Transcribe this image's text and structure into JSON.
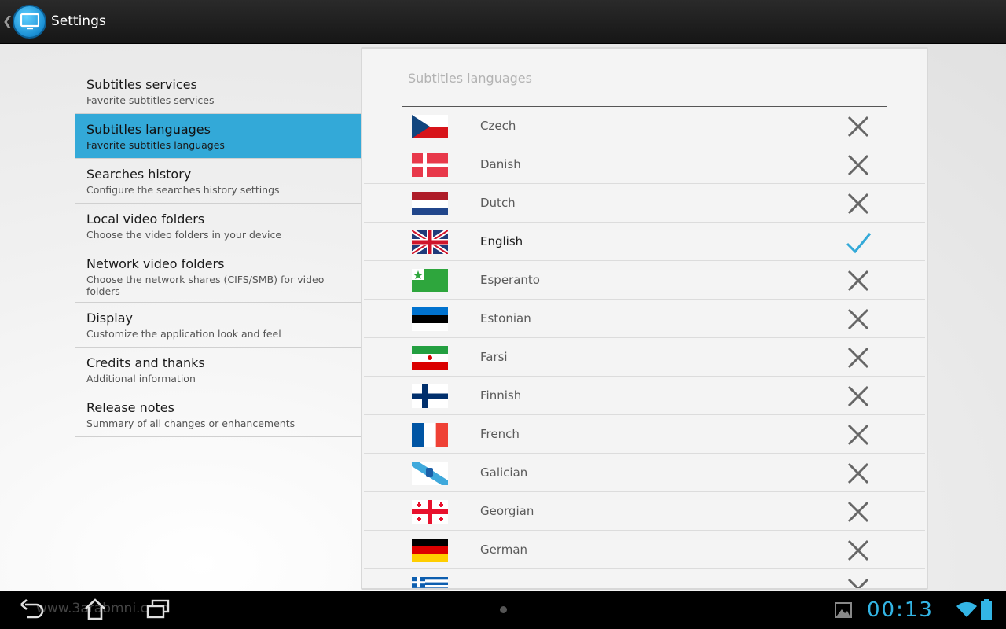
{
  "app": {
    "title": "Settings"
  },
  "headers": [
    {
      "title": "Subtitles services",
      "summary": "Favorite subtitles services",
      "selected": false
    },
    {
      "title": "Subtitles languages",
      "summary": "Favorite subtitles languages",
      "selected": true
    },
    {
      "title": "Searches history",
      "summary": "Configure the searches history settings",
      "selected": false
    },
    {
      "title": "Local video folders",
      "summary": "Choose the video folders in your device",
      "selected": false
    },
    {
      "title": "Network video folders",
      "summary": "Choose the network shares (CIFS/SMB) for video folders",
      "selected": false
    },
    {
      "title": "Display",
      "summary": "Customize the application look and feel",
      "selected": false
    },
    {
      "title": "Credits and thanks",
      "summary": "Additional information",
      "selected": false
    },
    {
      "title": "Release notes",
      "summary": "Summary of all changes or enhancements",
      "selected": false
    }
  ],
  "panel": {
    "title": "Subtitles languages",
    "languages": [
      {
        "name": "Czech",
        "flag": "czech-flag-icon",
        "selected": false
      },
      {
        "name": "Danish",
        "flag": "danish-flag-icon",
        "selected": false
      },
      {
        "name": "Dutch",
        "flag": "dutch-flag-icon",
        "selected": false
      },
      {
        "name": "English",
        "flag": "english-flag-icon",
        "selected": true
      },
      {
        "name": "Esperanto",
        "flag": "esperanto-flag-icon",
        "selected": false
      },
      {
        "name": "Estonian",
        "flag": "estonian-flag-icon",
        "selected": false
      },
      {
        "name": "Farsi",
        "flag": "farsi-flag-icon",
        "selected": false
      },
      {
        "name": "Finnish",
        "flag": "finnish-flag-icon",
        "selected": false
      },
      {
        "name": "French",
        "flag": "french-flag-icon",
        "selected": false
      },
      {
        "name": "Galician",
        "flag": "galician-flag-icon",
        "selected": false
      },
      {
        "name": "Georgian",
        "flag": "georgian-flag-icon",
        "selected": false
      },
      {
        "name": "German",
        "flag": "german-flag-icon",
        "selected": false
      },
      {
        "name": "",
        "flag": "greek-flag-icon",
        "selected": false
      }
    ]
  },
  "navbar": {
    "watermark": "www.3arabmni.com",
    "clock": "00:13"
  },
  "colors": {
    "accent": "#33b5e5",
    "selected_header": "#33a9d8",
    "check": "#33a9d8",
    "cross": "#666666"
  }
}
